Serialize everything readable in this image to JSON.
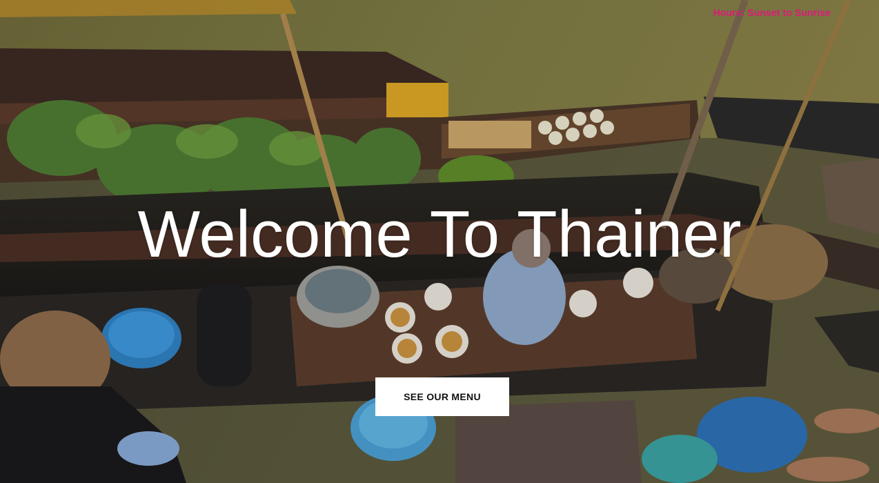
{
  "header": {
    "hours": "Hours: Sunset to Sunrise"
  },
  "hero": {
    "title": "Welcome To Thainer",
    "cta_label": "SEE OUR MENU",
    "background_description": "floating-market-photo"
  },
  "colors": {
    "hours_text": "#e0187a",
    "headline_text": "#ffffff",
    "button_bg": "#ffffff",
    "button_text": "#111111"
  }
}
